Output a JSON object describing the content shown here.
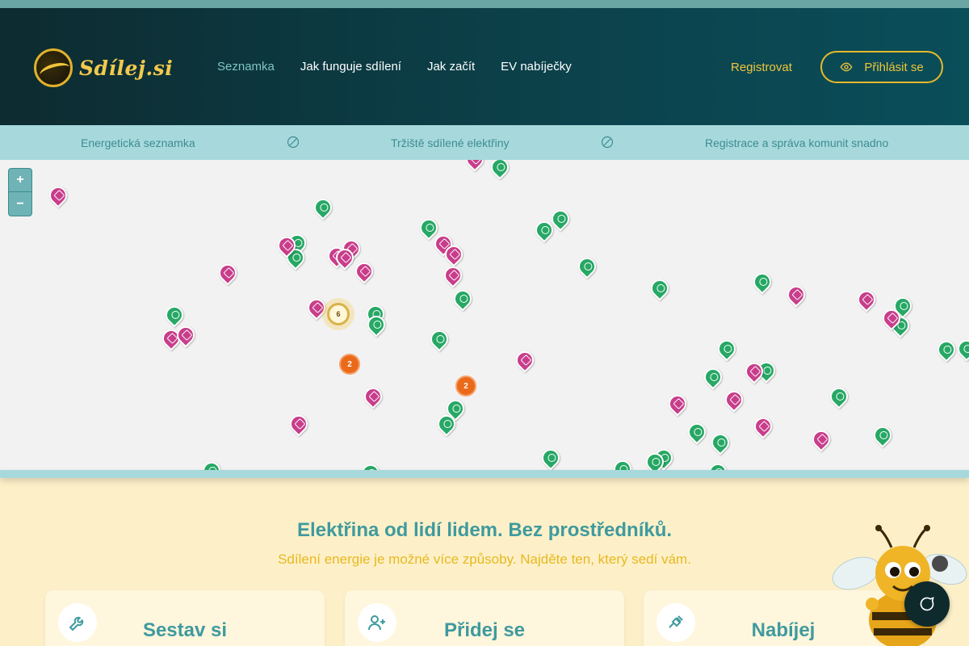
{
  "brand": {
    "name": "Sdílej.si"
  },
  "nav": [
    {
      "label": "Seznamka",
      "active": true
    },
    {
      "label": "Jak funguje sdílení",
      "active": false
    },
    {
      "label": "Jak začít",
      "active": false
    },
    {
      "label": "EV nabíječky",
      "active": false
    }
  ],
  "auth": {
    "register_label": "Registrovat",
    "login_label": "Přihlásit se"
  },
  "subbar": {
    "items": [
      "Energetická seznamka",
      "Tržiště sdílené elektřiny",
      "Registrace a správa komunit snadno"
    ]
  },
  "map": {
    "zoom_in": "+",
    "zoom_out": "−",
    "clusters": [
      {
        "count": "6",
        "kind": "sun"
      },
      {
        "count": "2",
        "kind": "orange"
      },
      {
        "count": "2",
        "kind": "orange"
      }
    ]
  },
  "section": {
    "title": "Elektřina od lidí lidem. Bez prostředníků.",
    "subtitle": "Sdílení energie je možné více způsoby. Najděte ten, který sedí vám."
  },
  "cards": [
    {
      "title": "Sestav si",
      "icon": "wrench-icon"
    },
    {
      "title": "Přidej se",
      "icon": "user-plus-icon"
    },
    {
      "title": "Nabíjej",
      "icon": "plug-icon"
    }
  ],
  "colors": {
    "accent": "#3f9a9e",
    "gold": "#f0c53a",
    "green_pin": "#27a865",
    "pink_pin": "#c83e8b",
    "cluster": "#ea6a1a"
  }
}
